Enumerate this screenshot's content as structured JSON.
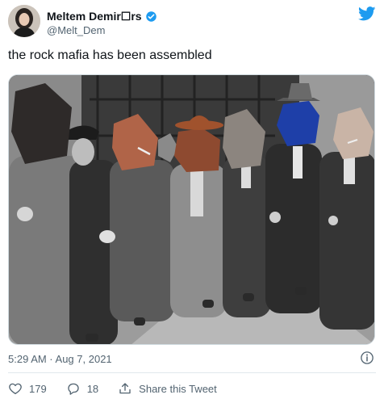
{
  "author": {
    "display_name": "Meltem Demir☐rs",
    "handle": "@Melt_Dem",
    "verified": true
  },
  "tweet": {
    "text": "the rock mafia has been assembled",
    "timestamp": "5:29 AM · Aug 7, 2021"
  },
  "actions": {
    "likes": "179",
    "replies": "18",
    "share_label": "Share this Tweet"
  },
  "icons": {
    "bird": "twitter-bird-icon",
    "verified": "verified-badge-icon",
    "info": "info-icon",
    "heart": "heart-icon",
    "reply": "reply-icon",
    "share": "share-icon"
  },
  "colors": {
    "brand": "#1d9bf0",
    "text": "#0f1419",
    "muted": "#536471"
  }
}
